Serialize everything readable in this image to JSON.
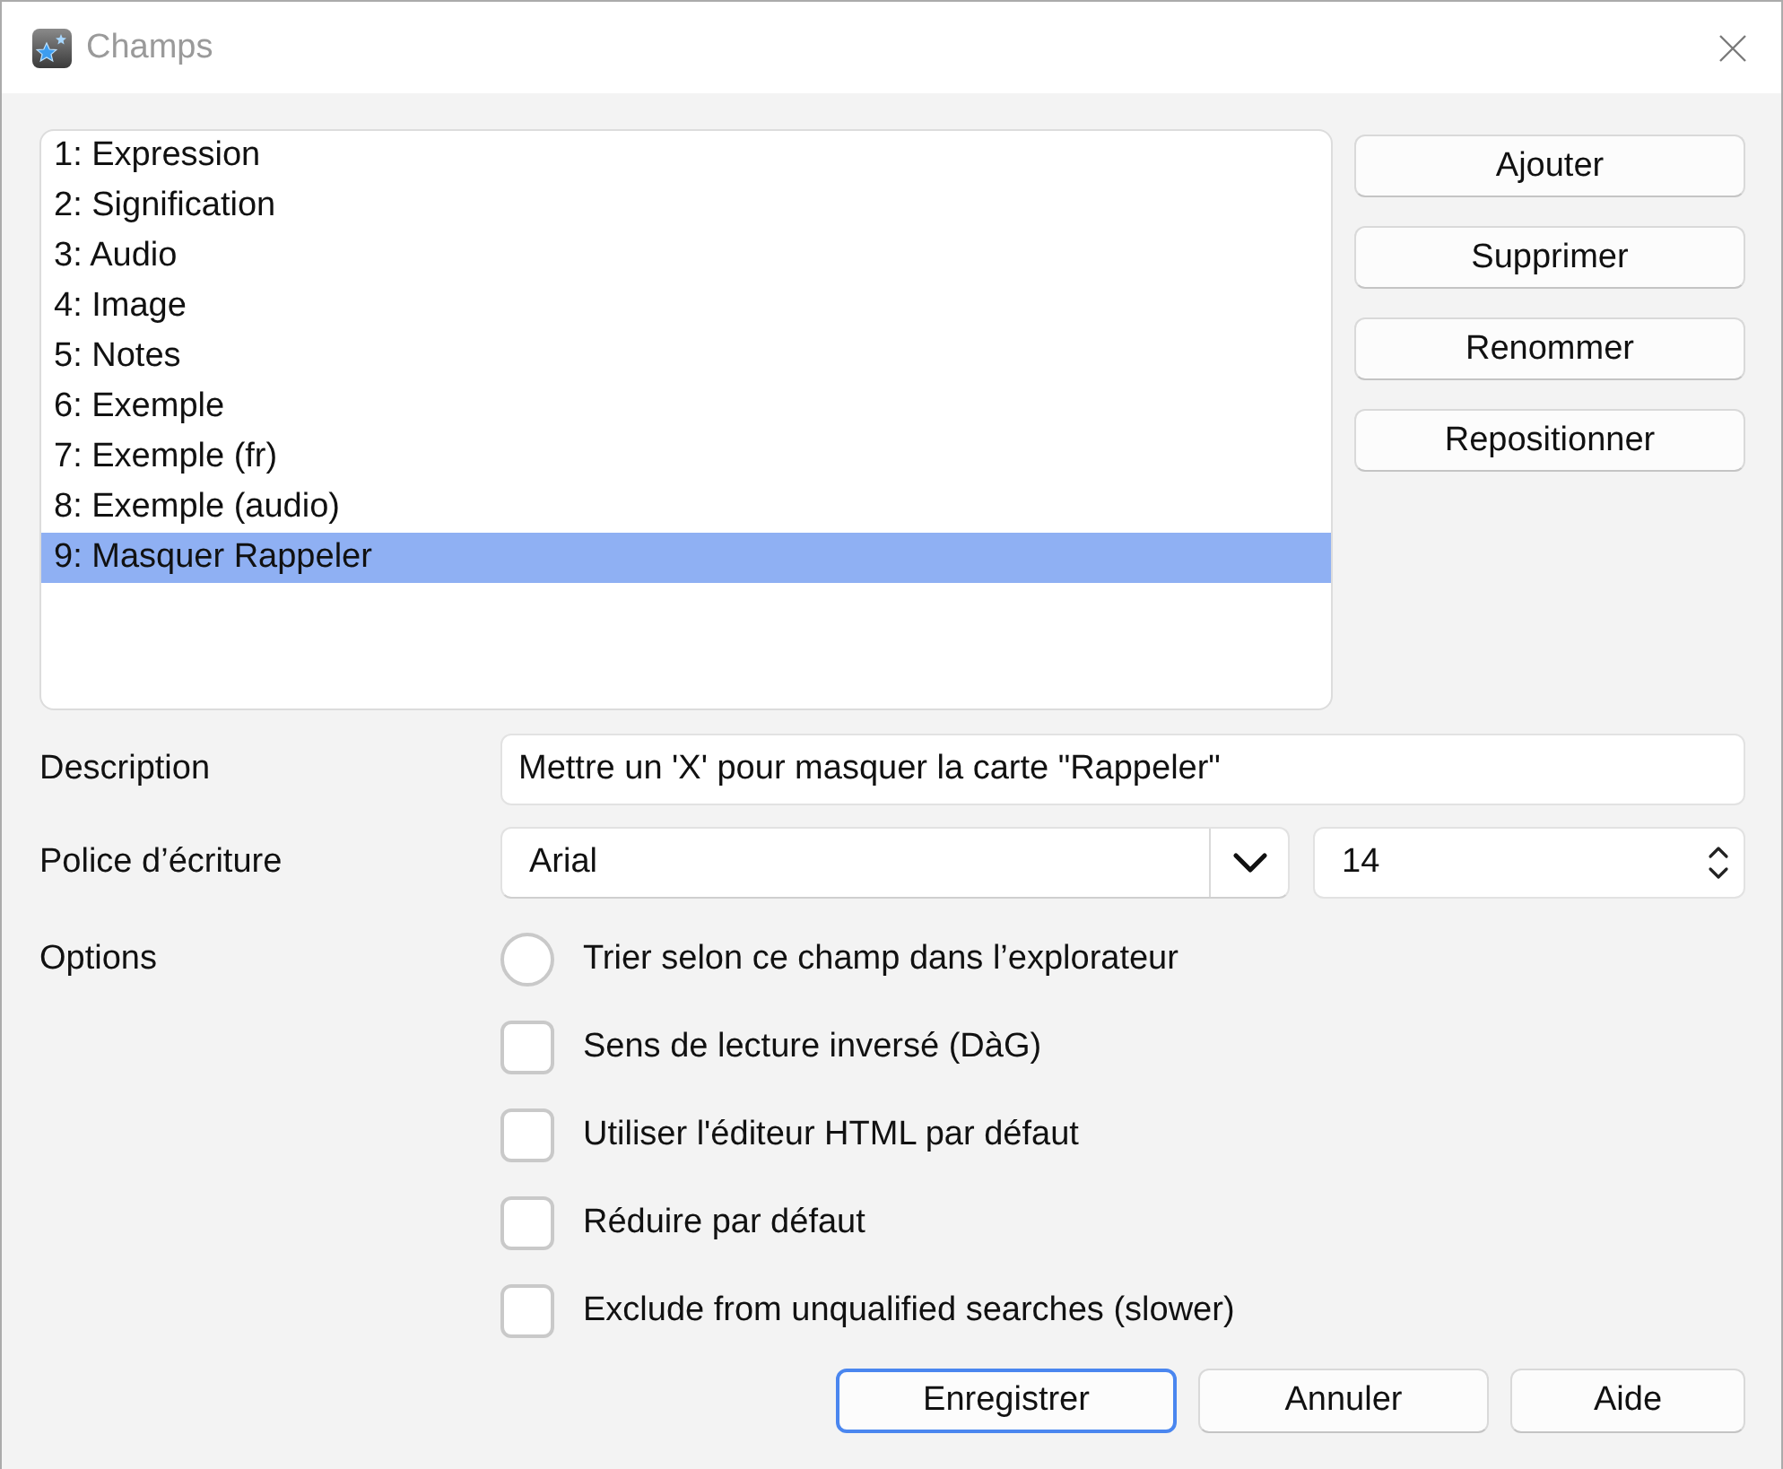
{
  "window": {
    "title": "Champs"
  },
  "fields": {
    "items": [
      {
        "label": "1: Expression",
        "selected": false
      },
      {
        "label": "2: Signification",
        "selected": false
      },
      {
        "label": "3: Audio",
        "selected": false
      },
      {
        "label": "4: Image",
        "selected": false
      },
      {
        "label": "5: Notes",
        "selected": false
      },
      {
        "label": "6: Exemple",
        "selected": false
      },
      {
        "label": "7: Exemple (fr)",
        "selected": false
      },
      {
        "label": "8: Exemple (audio)",
        "selected": false
      },
      {
        "label": "9: Masquer Rappeler",
        "selected": true
      }
    ]
  },
  "actions": [
    "Ajouter",
    "Supprimer",
    "Renommer",
    "Repositionner"
  ],
  "description": {
    "label": "Description",
    "value": "Mettre un 'X' pour masquer la carte \"Rappeler\""
  },
  "font": {
    "label": "Police d’écriture",
    "family": "Arial",
    "size": "14"
  },
  "options": {
    "label": "Options",
    "items": [
      {
        "kind": "radio",
        "label": "Trier selon ce champ dans l’explorateur",
        "checked": false
      },
      {
        "kind": "checkbox",
        "label": "Sens de lecture inversé (DàG)",
        "checked": false
      },
      {
        "kind": "checkbox",
        "label": "Utiliser l'éditeur HTML par défaut",
        "checked": false
      },
      {
        "kind": "checkbox",
        "label": "Réduire par défaut",
        "checked": false
      },
      {
        "kind": "checkbox",
        "label": "Exclude from unqualified searches (slower)",
        "checked": false
      }
    ]
  },
  "buttons": [
    {
      "label": "Enregistrer",
      "default": true
    },
    {
      "label": "Annuler",
      "default": false
    },
    {
      "label": "Aide",
      "default": false
    }
  ]
}
